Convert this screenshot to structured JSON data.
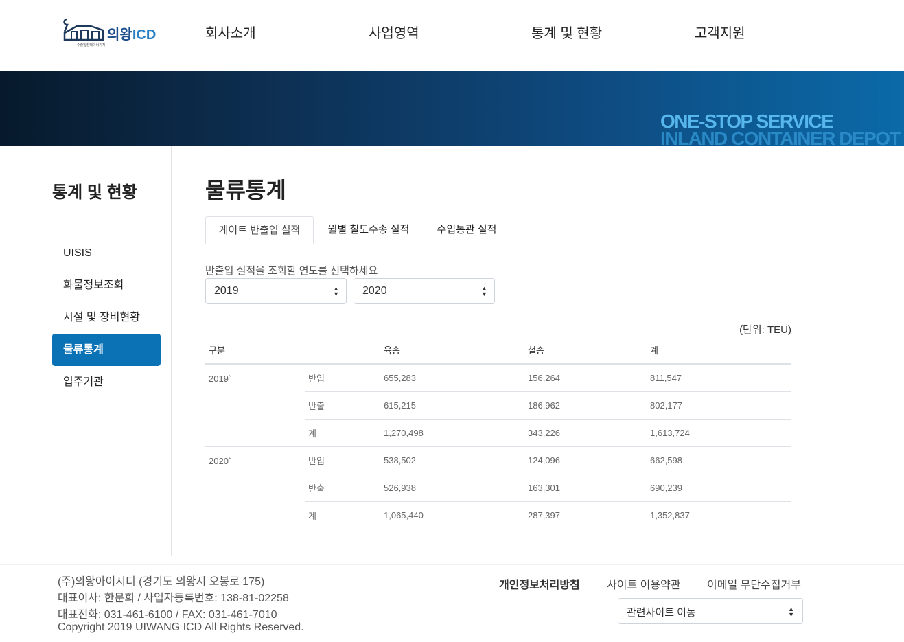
{
  "header": {
    "logo": {
      "brand": "의왕",
      "icd": "ICD",
      "sub": "수출입컨테이너기지"
    },
    "nav": [
      "회사소개",
      "사업영역",
      "통계 및 현황",
      "고객지원"
    ]
  },
  "banner": {
    "line1": "ONE-STOP SERVICE",
    "line2": "INLAND CONTAINER DEPOT"
  },
  "sidebar": {
    "title": "통계 및 현황",
    "items": [
      {
        "label": "UISIS"
      },
      {
        "label": "화물정보조회"
      },
      {
        "label": "시설 및 장비현황"
      },
      {
        "label": "물류통계",
        "active": true
      },
      {
        "label": "입주기관"
      }
    ]
  },
  "main": {
    "title": "물류통계",
    "tabs": [
      "게이트 반출입 실적",
      "월별 철도수송 실적",
      "수입통관 실적"
    ],
    "active_tab": 0,
    "select_label": "반출입 실적을 조회할 연도를 선택하세요",
    "year_from": "2019",
    "year_to": "2020",
    "unit": "(단위: TEU)",
    "table": {
      "headers": [
        "구분",
        "",
        "육송",
        "철송",
        "계"
      ],
      "groups": [
        {
          "year": "2019`",
          "rows": [
            [
              "반입",
              "655,283",
              "156,264",
              "811,547"
            ],
            [
              "반출",
              "615,215",
              "186,962",
              "802,177"
            ],
            [
              "계",
              "1,270,498",
              "343,226",
              "1,613,724"
            ]
          ]
        },
        {
          "year": "2020`",
          "rows": [
            [
              "반입",
              "538,502",
              "124,096",
              "662,598"
            ],
            [
              "반출",
              "526,938",
              "163,301",
              "690,239"
            ],
            [
              "계",
              "1,065,440",
              "287,397",
              "1,352,837"
            ]
          ]
        }
      ]
    }
  },
  "footer": {
    "company": "(주)의왕아이시디 (경기도 의왕시 오봉로 175)",
    "ceo": "대표이사: 한문희 / 사업자등록번호: 138-81-02258",
    "phone": "대표전화: 031-461-6100 / FAX: 031-461-7010",
    "copyright": "Copyright 2019 UIWANG ICD All Rights Reserved.",
    "links": [
      "개인정보처리방침",
      "사이트 이용약관",
      "이메일 무단수집거부"
    ],
    "related_select": "관련사이트 이동"
  },
  "colors": {
    "accent": "#0b72b5",
    "banner_dark": "#071a2c",
    "banner_light": "#0b6aa8"
  }
}
